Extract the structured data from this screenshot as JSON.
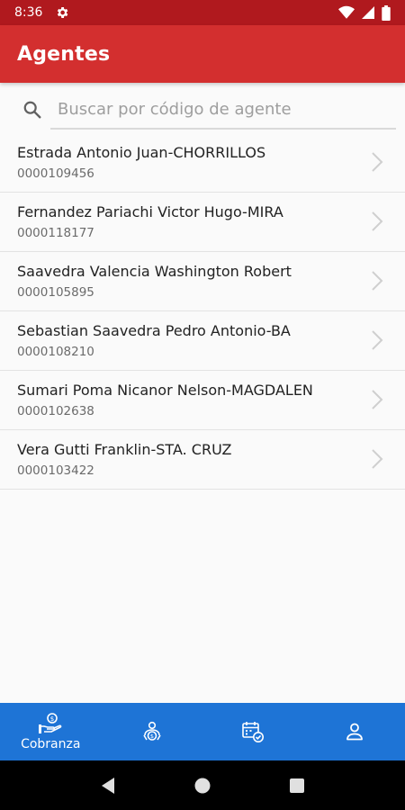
{
  "status_bar": {
    "time": "8:36"
  },
  "app_bar": {
    "title": "Agentes"
  },
  "search": {
    "placeholder": "Buscar por código de agente"
  },
  "agents": [
    {
      "name": "Estrada Antonio Juan-CHORRILLOS",
      "code": "0000109456"
    },
    {
      "name": "Fernandez Pariachi Victor Hugo-MIRA",
      "code": "0000118177"
    },
    {
      "name": "Saavedra Valencia Washington Robert",
      "code": "0000105895"
    },
    {
      "name": "Sebastian Saavedra Pedro Antonio-BA",
      "code": "0000108210"
    },
    {
      "name": "Sumari Poma Nicanor Nelson-MAGDALEN",
      "code": "0000102638"
    },
    {
      "name": "Vera Gutti Franklin-STA. CRUZ",
      "code": "0000103422"
    }
  ],
  "bottom_nav": {
    "items": [
      {
        "label": "Cobranza",
        "icon": "hand-money-icon",
        "active": true
      },
      {
        "label": "",
        "icon": "person-money-icon",
        "active": false
      },
      {
        "label": "",
        "icon": "calendar-check-icon",
        "active": false
      },
      {
        "label": "",
        "icon": "person-icon",
        "active": false
      }
    ]
  },
  "colors": {
    "status_bar": "#b0191e",
    "app_bar": "#d32f2f",
    "bottom_nav": "#1e74d6"
  }
}
